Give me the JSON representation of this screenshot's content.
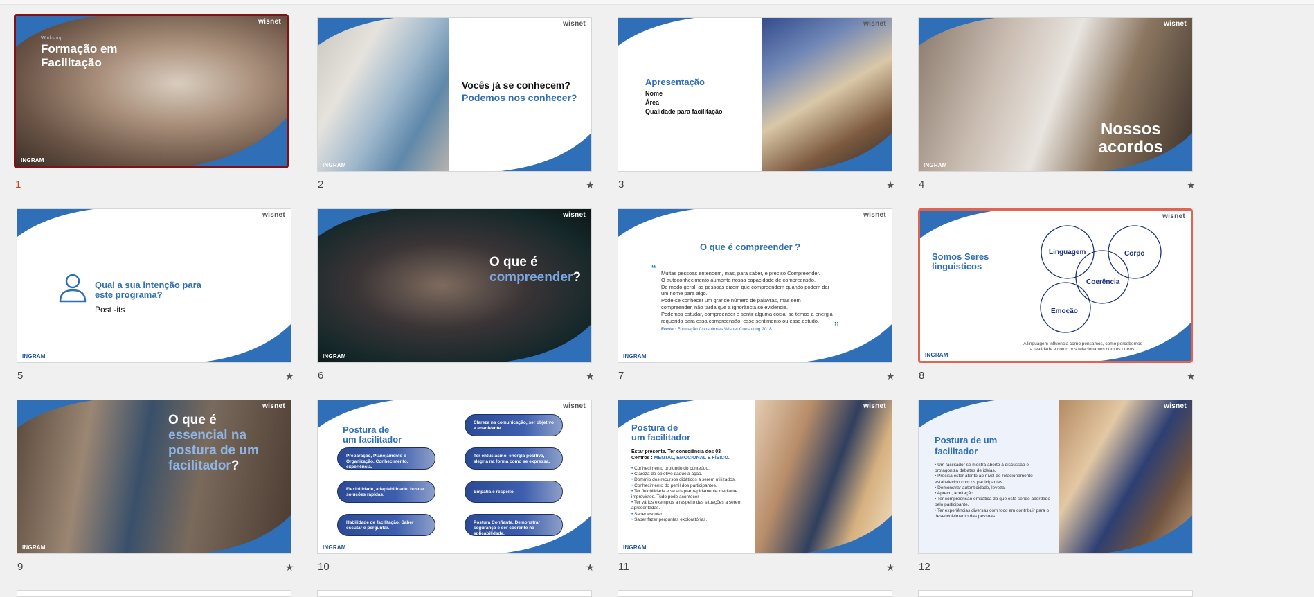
{
  "slides": [
    {
      "num": "1",
      "wisnet": "wisnet",
      "eyebrow": "Workshop",
      "title_l1": "Formação em",
      "title_l2": "Facilitação",
      "ingram": "INGRAM"
    },
    {
      "num": "2",
      "wisnet": "wisnet",
      "line1": "Vocês já se conhecem?",
      "line2": "Podemos nos conhecer?",
      "ingram": "INGRAM",
      "star": "★"
    },
    {
      "num": "3",
      "wisnet": "wisnet",
      "title": "Apresentação",
      "items": [
        "Nome",
        "Área",
        "Qualidade para facilitação"
      ],
      "star": "★"
    },
    {
      "num": "4",
      "wisnet": "wisnet",
      "title_l1": "Nossos",
      "title_l2": "acordos",
      "ingram": "INGRAM",
      "star": "★"
    },
    {
      "num": "5",
      "wisnet": "wisnet",
      "q_l1": "Qual a sua intenção para",
      "q_l2": "este programa?",
      "sub": "Post -its",
      "ingram": "INGRAM",
      "star": "★"
    },
    {
      "num": "6",
      "wisnet": "wisnet",
      "l1": "O que é",
      "l2": "compreender",
      "l2_tail": "?",
      "ingram": "INGRAM",
      "star": "★"
    },
    {
      "num": "7",
      "wisnet": "wisnet",
      "title": "O que é compreender ?",
      "quote": [
        "Muitas pessoas entendem, mas, para saber, é preciso Compreender.",
        "O autoconhecimento aumenta nossa capacidade de compreensão.",
        "De modo geral, as pessoas dizem que compreendem quando podem dar",
        "um nome para algo.",
        "Pode-se conhecer um grande número de palavras, mas sem",
        "compreender, não tarda que a ignorância se evidencie.",
        "Podemos estudar, compreender e sentir alguma coisa, se temos a energia",
        "requerida para essa compreensão, esse sentimento ou esse estudo."
      ],
      "source_label": "Fonte :",
      "source": "Formação Consultores Wisnet Consulting 2018",
      "ingram": "INGRAM",
      "star": "★"
    },
    {
      "num": "8",
      "wisnet": "wisnet",
      "t_l1": "Somos Seres",
      "t_l2": "linguisticos",
      "circles": [
        "Linguagem",
        "Corpo",
        "Coerência",
        "Emoção"
      ],
      "caption_l1": "A linguagem influencia como pensamos, como percebemos",
      "caption_l2": "a realidade e como nos relacionamos com os outros.",
      "ingram": "INGRAM",
      "star": "★"
    },
    {
      "num": "9",
      "wisnet": "wisnet",
      "l1": "O que é",
      "l2": "essencial na",
      "l3": "postura de um",
      "l4": "facilitador",
      "l4_tail": "?",
      "ingram": "INGRAM",
      "star": "★"
    },
    {
      "num": "10",
      "wisnet": "wisnet",
      "t_l1": "Postura de",
      "t_l2": "um facilitador",
      "pills": [
        "Preparação, Planejamento e Organização. Conhecimento, experiência.",
        "Flexibilidade, adaptabilidade, buscar soluções rápidas.",
        "Habilidade de facilitação. Saber escutar e perguntar.",
        "Clareza na comunicação, ser objetivo e envolvente.",
        "Ter entusiasmo, energia positiva, alegria na forma como se expressa.",
        "Empatia e respeito",
        "Postura Confiante. Demonstrar segurança e ser coerente na aplicabilidade."
      ],
      "ingram": "INGRAM",
      "star": "★"
    },
    {
      "num": "11",
      "wisnet": "wisnet",
      "t_l1": "Postura de",
      "t_l2": "um facilitador",
      "intro_l1": "Estar presente. Ter consciência dos 03",
      "intro_l2": "Centros :",
      "intro_hl": "MENTAL, EMOCIONAL E FÍSICO.",
      "bullets": [
        "Conhecimento profundo do conteúdo.",
        "Clareza do objetivo daquela ação.",
        "Domínio dos recursos didáticos a serem utilizados.",
        "Conhecimento do perfil dos participantes.",
        "Ter flexibilidade e se adaptar rapidamente mediante imprevistos. Tudo pode acontecer !",
        "Ter vários exemplos a respeito das situações a serem apresentadas.",
        "Saber escutar.",
        "Saber fazer perguntas exploratórias."
      ],
      "ingram": "INGRAM",
      "star": "★"
    },
    {
      "num": "12",
      "wisnet": "wisnet",
      "t_l1": "Postura de um",
      "t_l2": "facilitador",
      "bullets": [
        "Um facilitador se mostra aberto à discussão e protagoniza debates de ideias.",
        "Precisa estar atento ao nível de relacionamento estabelecido com os participantes.",
        "Demonstrar autenticidade, leveza.",
        "Apreço, aceitação.",
        "Ter compreensão empática do que está sendo abordado pelo participante.",
        "Ter experiências diversas com foco em contribuir para o desenvolvimento das pessoas."
      ]
    }
  ],
  "colors": {
    "brand_blue": "#2f6fb8",
    "navy": "#17317a",
    "selected_border": "#7d1218",
    "hover_border": "#e0644f",
    "active_number": "#c4491b"
  }
}
